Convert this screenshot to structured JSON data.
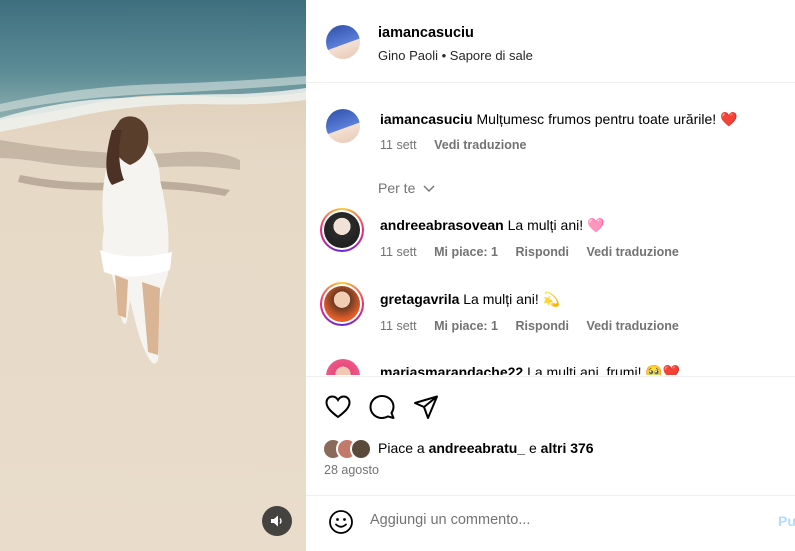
{
  "header": {
    "username": "iamancasuciu",
    "audio_artist": "Gino Paoli",
    "audio_separator": "•",
    "audio_title": "Sapore di sale"
  },
  "caption": {
    "username": "iamancasuciu",
    "text": "Mulțumesc frumos pentru toate urările! ❤️",
    "time": "11 sett",
    "translate": "Vedi traduzione"
  },
  "section_label": "Per te",
  "comments": [
    {
      "username": "andreeabrasovean",
      "text": "La mulți ani! 🩷",
      "time": "11 sett",
      "likes": "Mi piace: 1",
      "reply": "Rispondi",
      "translate": "Vedi traduzione"
    },
    {
      "username": "gretagavrila",
      "text": "La mulți ani! 💫",
      "time": "11 sett",
      "likes": "Mi piace: 1",
      "reply": "Rispondi",
      "translate": "Vedi traduzione"
    },
    {
      "username": "mariasmarandache22",
      "text": "La mulți ani, frumi! 🥹❤️",
      "time": "",
      "likes": "",
      "reply": "",
      "translate": ""
    }
  ],
  "likes": {
    "prefix": "Piace a",
    "user": "andreeabratu_",
    "middle": "e",
    "others": "altri 376"
  },
  "post_date": "28 agosto",
  "add_comment": {
    "placeholder": "Aggiungi un commento...",
    "post_label": "Pu"
  },
  "icons": {
    "like": "heart-outline-icon",
    "comment": "comment-bubble-icon",
    "share": "paper-plane-icon",
    "emoji": "smiley-icon",
    "volume": "speaker-icon"
  },
  "colors": {
    "accent": "#e8344a",
    "post_button": "#b3dbff",
    "muted_text": "#737373"
  }
}
